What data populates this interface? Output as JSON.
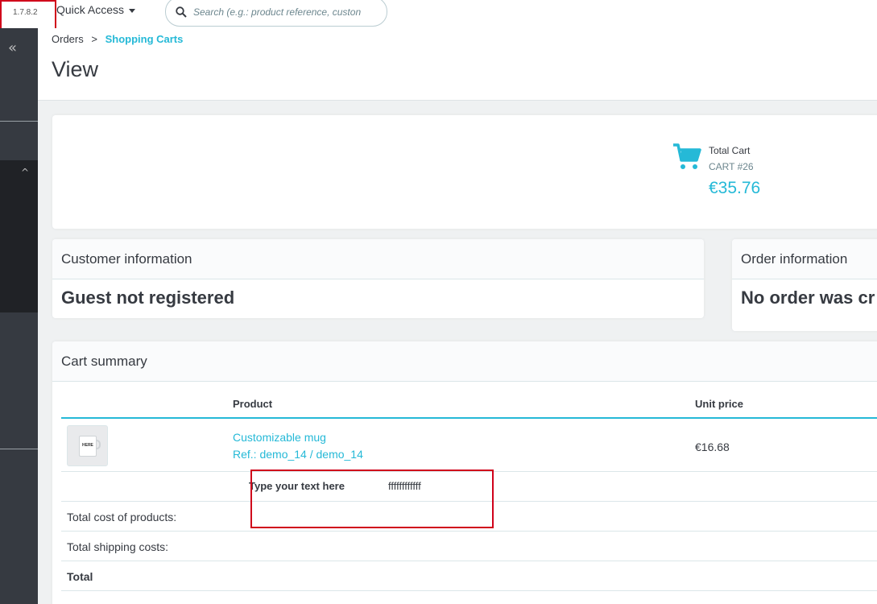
{
  "header": {
    "version": "1.7.8.2",
    "quick_access_label": "Quick Access",
    "search_placeholder": "Search (e.g.: product reference, custon"
  },
  "sidebar": {
    "collapse_label": "«",
    "expand_label": "^"
  },
  "breadcrumb": {
    "parent": "Orders",
    "separator": ">",
    "current": "Shopping Carts"
  },
  "page_title": "View",
  "total_cart": {
    "label": "Total Cart",
    "reference": "CART #26",
    "amount": "€35.76"
  },
  "customer_info": {
    "title": "Customer information",
    "value": "Guest not registered"
  },
  "order_info": {
    "title": "Order information",
    "value": "No order was cr"
  },
  "cart_summary": {
    "title": "Cart summary",
    "columns": {
      "product": "Product",
      "unit_price": "Unit price"
    },
    "product": {
      "image_text": "HERE",
      "name": "Customizable mug",
      "reference": "Ref.: demo_14 / demo_14",
      "unit_price": "€16.68",
      "customization_label": "Type your text here",
      "customization_value": "ffffffffffff"
    },
    "totals": {
      "products": "Total cost of products:",
      "shipping": "Total shipping costs:",
      "total": "Total"
    }
  },
  "colors": {
    "accent": "#25b9d7",
    "sidebar": "#363a41",
    "highlight": "#d0021b"
  }
}
